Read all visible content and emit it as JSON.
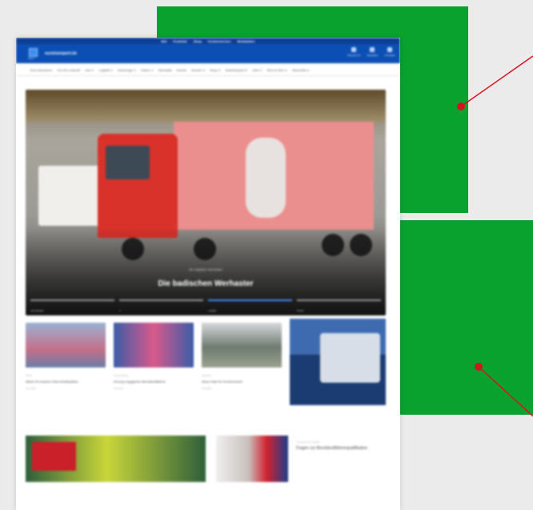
{
  "colors": {
    "annotation_panel": "#0aa22f",
    "annotation_marker": "#d4141f",
    "site_header": "#0b4fb4",
    "top_strip": "#0d3f96"
  },
  "site": {
    "top_links": [
      "Mol",
      "Produkte",
      "Shop",
      "Kundenservice",
      "Mediadaten"
    ],
    "brand": "eurotransport.de",
    "logo_caption": "Menü",
    "header_actions": [
      {
        "label": "Themen A-Z",
        "icon": "list-icon"
      },
      {
        "label": "Newsletter",
        "icon": "mail-icon"
      },
      {
        "label": "Anmelden",
        "icon": "user-icon"
      }
    ],
    "nav": [
      "Euro Abonieren",
      "Für Ihre Zukunft",
      "Lkw ∨",
      "Logistik ∨",
      "Fahrzeuge ∨",
      "Fahrer ∨",
      "Werkstatt",
      "Events",
      "Service ∨",
      "Shop ∨",
      "Autotransport 5",
      "Jobs ∨",
      "Who is Who ∨",
      "Abo/Hefte ∨"
    ]
  },
  "hero": {
    "kicker": "Die Digitalen Neuheiten",
    "title": "Die badischen Werhaster",
    "indicators": [
      "Lkw Modelle",
      "1.",
      "Logistik",
      "Preise"
    ]
  },
  "cards": [
    {
      "kicker": "Politik",
      "title": "Aktion für bessere Rast Arbeitsplätze",
      "meta": "vor 1 Std"
    },
    {
      "kicker": "Veranstaltung",
      "title": "Ehrung engagierter Berufskraftfahrer",
      "meta": "vor 3 Std"
    },
    {
      "kicker": "Spedition",
      "title": "Neue Halle für Kombiverkehr",
      "meta": "vor 5 Std"
    }
  ],
  "bottom_teaser": {
    "kicker": "Transport und Logistik",
    "title": "Fragen zur Berufskraftfahrerqualifikation"
  }
}
